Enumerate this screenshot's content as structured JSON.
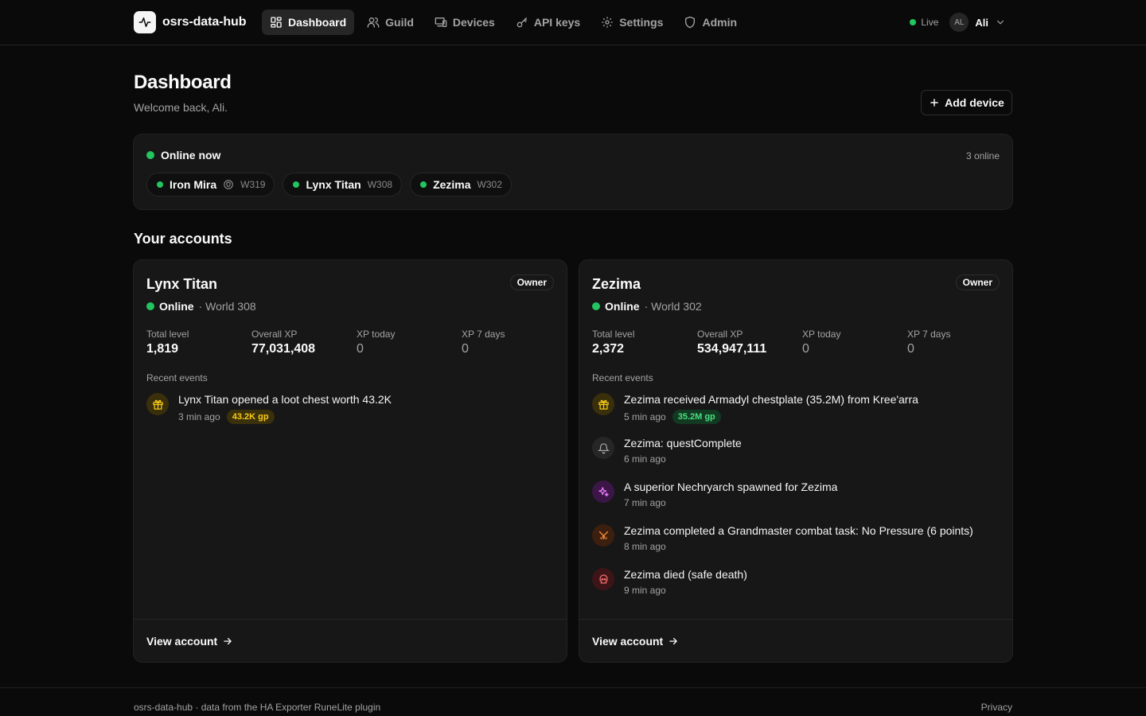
{
  "brand": {
    "name": "osrs-data-hub",
    "logo_icon": "activity-icon"
  },
  "nav": [
    {
      "label": "Dashboard",
      "icon": "grid-icon",
      "active": true
    },
    {
      "label": "Guild",
      "icon": "users-icon",
      "active": false
    },
    {
      "label": "Devices",
      "icon": "devices-icon",
      "active": false
    },
    {
      "label": "API keys",
      "icon": "key-icon",
      "active": false
    },
    {
      "label": "Settings",
      "icon": "gear-icon",
      "active": false
    },
    {
      "label": "Admin",
      "icon": "shield-icon",
      "active": false
    }
  ],
  "status": {
    "live_label": "Live",
    "color": "#22c55e"
  },
  "user": {
    "initials": "AL",
    "name": "Ali"
  },
  "header": {
    "title": "Dashboard",
    "subtitle": "Welcome back, Ali.",
    "add_device_label": "Add device"
  },
  "online": {
    "heading": "Online now",
    "count_label": "3 online",
    "players": [
      {
        "name": "Iron Mira",
        "world": "W319",
        "ironman": true
      },
      {
        "name": "Lynx Titan",
        "world": "W308",
        "ironman": false
      },
      {
        "name": "Zezima",
        "world": "W302",
        "ironman": false
      }
    ]
  },
  "accounts_title": "Your accounts",
  "accounts": [
    {
      "name": "Lynx Titan",
      "role": "Owner",
      "status": "Online",
      "world": "· World 308",
      "stats": [
        {
          "label": "Total level",
          "value": "1,819"
        },
        {
          "label": "Overall XP",
          "value": "77,031,408"
        },
        {
          "label": "XP today",
          "value": "0"
        },
        {
          "label": "XP 7 days",
          "value": "0"
        }
      ],
      "events_label": "Recent events",
      "events": [
        {
          "type": "loot",
          "icon": "gift-icon",
          "text": "Lynx Titan opened a loot chest worth 43.2K",
          "time": "3 min ago",
          "pill": "43.2K gp",
          "pill_color": "#facc15"
        }
      ],
      "view_label": "View account"
    },
    {
      "name": "Zezima",
      "role": "Owner",
      "status": "Online",
      "world": "· World 302",
      "stats": [
        {
          "label": "Total level",
          "value": "2,372"
        },
        {
          "label": "Overall XP",
          "value": "534,947,111"
        },
        {
          "label": "XP today",
          "value": "0"
        },
        {
          "label": "XP 7 days",
          "value": "0"
        }
      ],
      "events_label": "Recent events",
      "events": [
        {
          "type": "loot",
          "icon": "gift-icon",
          "text": "Zezima received Armadyl chestplate (35.2M) from Kree'arra",
          "time": "5 min ago",
          "pill": "35.2M gp",
          "pill_color": "#4ade80"
        },
        {
          "type": "quest",
          "icon": "bell-icon",
          "text": "Zezima: questComplete",
          "time": "6 min ago",
          "pill": null,
          "pill_color": null
        },
        {
          "type": "superior",
          "icon": "sparkles-icon",
          "text": "A superior Nechryarch spawned for Zezima",
          "time": "7 min ago",
          "pill": null,
          "pill_color": null
        },
        {
          "type": "combat",
          "icon": "swords-icon",
          "text": "Zezima completed a Grandmaster combat task: No Pressure (6 points)",
          "time": "8 min ago",
          "pill": null,
          "pill_color": null
        },
        {
          "type": "death",
          "icon": "skull-icon",
          "text": "Zezima died (safe death)",
          "time": "9 min ago",
          "pill": null,
          "pill_color": null
        }
      ],
      "view_label": "View account"
    }
  ],
  "footer": {
    "text": "osrs-data-hub · data from the HA Exporter RuneLite plugin",
    "privacy": "Privacy"
  }
}
